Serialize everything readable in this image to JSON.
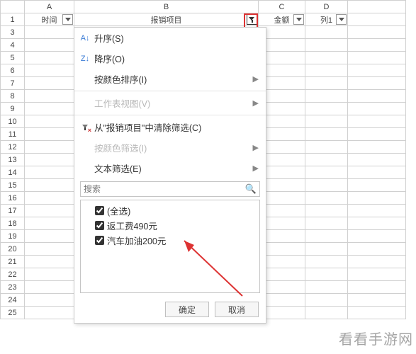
{
  "columns": {
    "A": "A",
    "B": "B",
    "C": "C",
    "D": "D"
  },
  "header_row": {
    "A": "时间",
    "B": "报销项目",
    "C": "金额",
    "D": "列1",
    "B_filtered": true
  },
  "filter_menu": {
    "sort_asc": "升序(S)",
    "sort_desc": "降序(O)",
    "sort_by_color": "按颜色排序(I)",
    "sheet_view": "工作表视图(V)",
    "clear_filter": "从\"报销项目\"中清除筛选(C)",
    "filter_by_color": "按颜色筛选(I)",
    "text_filter": "文本筛选(E)",
    "search_placeholder": "搜索",
    "items": {
      "select_all": "(全选)",
      "item1": "返工费490元",
      "item2": "汽车加油200元"
    },
    "ok": "确定",
    "cancel": "取消"
  },
  "watermark": "看看手游网"
}
